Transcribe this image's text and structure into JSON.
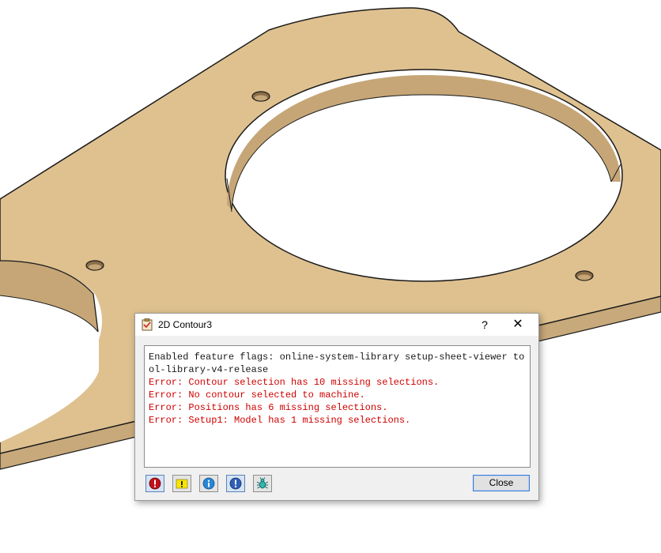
{
  "dialog": {
    "title": "2D Contour3",
    "help_label": "?",
    "close_glyph": "✕",
    "log_lines": [
      {
        "type": "info",
        "text": "Enabled feature flags: online-system-library setup-sheet-viewer tool-library-v4-release"
      },
      {
        "type": "error",
        "text": "Error: Contour selection has 10 missing selections."
      },
      {
        "type": "error",
        "text": "Error: No contour selected to machine."
      },
      {
        "type": "error",
        "text": "Error: Positions has 6 missing selections."
      },
      {
        "type": "error",
        "text": "Error: Setup1: Model has 1 missing selections."
      }
    ],
    "filters": [
      {
        "name": "errors-filter",
        "icon": "error-icon",
        "active": true
      },
      {
        "name": "warnings-filter",
        "icon": "warning-icon",
        "active": false
      },
      {
        "name": "info-filter",
        "icon": "info-icon",
        "active": false
      },
      {
        "name": "messages-filter",
        "icon": "message-icon",
        "active": true
      },
      {
        "name": "debug-filter",
        "icon": "bug-icon",
        "active": false
      }
    ],
    "close_button": "Close"
  },
  "colors": {
    "error_text": "#d00000",
    "info_text": "#1a1a1a",
    "part_face": "#dfc190",
    "part_wall": "#c3a374",
    "accent": "#3a7bd5"
  }
}
